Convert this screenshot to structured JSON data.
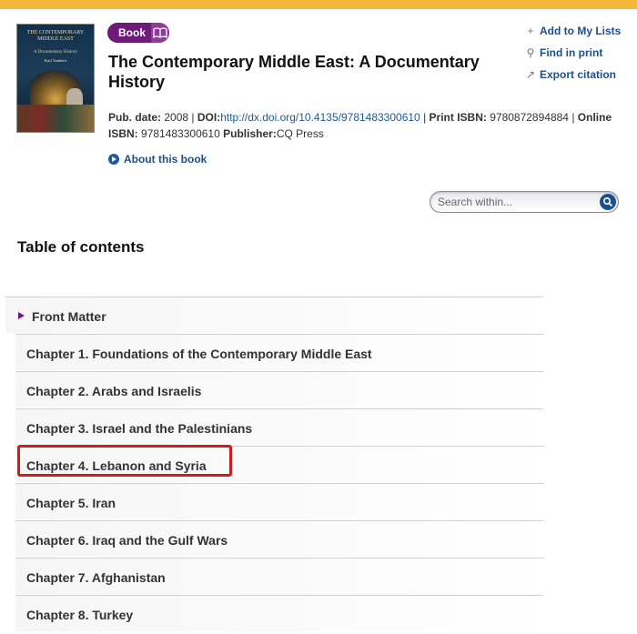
{
  "book": {
    "badge_label": "Book",
    "title": "The Contemporary Middle East: A Documentary History",
    "cover": {
      "title": "THE CONTEMPORARY MIDDLE EAST",
      "subtitle": "A Documentary History",
      "author": "Karl Yambert"
    },
    "meta": {
      "pub_date_label": "Pub. date:",
      "pub_date": "2008",
      "doi_label": "DOI:",
      "doi": "http://dx.doi.org/10.4135/9781483300610",
      "print_isbn_label": "Print ISBN:",
      "print_isbn": "9780872894884",
      "online_isbn_label": "Online ISBN:",
      "online_isbn": "9781483300610",
      "publisher_label": "Publisher:",
      "publisher": "CQ Press"
    },
    "about_label": "About this book"
  },
  "actions": {
    "add_to_lists": "Add to My Lists",
    "find_in_print": "Find in print",
    "export_citation": "Export citation"
  },
  "search": {
    "placeholder": "Search within..."
  },
  "toc": {
    "heading": "Table of contents",
    "items": [
      "Front Matter",
      "Chapter 1. Foundations of the Contemporary Middle East",
      "Chapter 2. Arabs and Israelis",
      "Chapter 3. Israel and the Palestinians",
      "Chapter 4. Lebanon and Syria",
      "Chapter 5. Iran",
      "Chapter 6. Iraq and the Gulf Wars",
      "Chapter 7. Afghanistan",
      "Chapter 8. Turkey"
    ]
  },
  "colors": {
    "top_bar": "#f3b73a",
    "badge": "#6d1a78",
    "link": "#1c4f8c",
    "highlight": "#d61a1a"
  }
}
